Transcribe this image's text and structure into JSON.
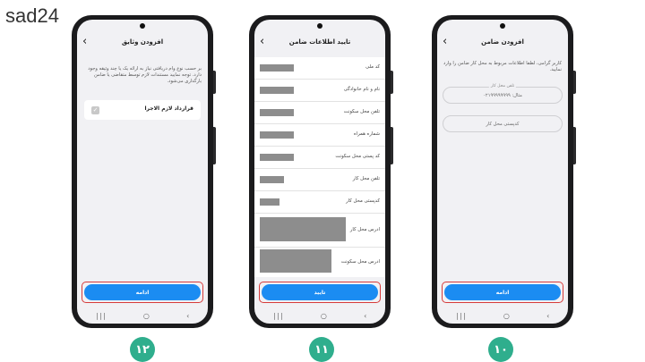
{
  "logo": "sad24",
  "screens": [
    {
      "title": "افزودن وثایق",
      "description": "بر حسب نوع وام دریافتی نیاز به ارائه یک یا چند وثیقه وجود دارد. توجه نمایید مستندات لازم توسط متقاضی یا ضامن بارگذاری می‌شود.",
      "document_label": "قرارداد لازم الاجرا",
      "button": "ادامه",
      "step_badge": "۱۲"
    },
    {
      "title": "تایید اطلاعات ضامن",
      "fields": [
        {
          "label": "کد ملی"
        },
        {
          "label": "نام و نام خانوادگی"
        },
        {
          "label": "تلفن محل سکونت"
        },
        {
          "label": "شماره همراه"
        },
        {
          "label": "کد پستی محل سکونت"
        },
        {
          "label": "تلفن محل کار"
        },
        {
          "label": "کدپستی محل کار"
        },
        {
          "label": "ادرس محل کار"
        },
        {
          "label": "ادرس محل سکونت"
        }
      ],
      "button": "تایید",
      "step_badge": "۱۱"
    },
    {
      "title": "افزودن ضامن",
      "description": "کاربر گرامی، لطفا اطلاعات مربوط به محل کار ضامن را وارد نمایید.",
      "phone_field": {
        "label": "تلفن محل کار",
        "placeholder": "مثال: ۰۲۱۹۹۹۹۹۹۹۹"
      },
      "postal_field": {
        "placeholder": "کدپستی محل کار"
      },
      "button": "ادامه",
      "step_badge": "۱۰"
    }
  ],
  "colors": {
    "accent": "#1b8cf2",
    "highlight": "#d63b3b",
    "badge": "#2fae8d",
    "redacted": "#8d8d8d"
  },
  "icons": [
    "back-arrow-icon",
    "checkbox-icon",
    "recent-apps-icon",
    "home-icon",
    "back-nav-icon"
  ]
}
